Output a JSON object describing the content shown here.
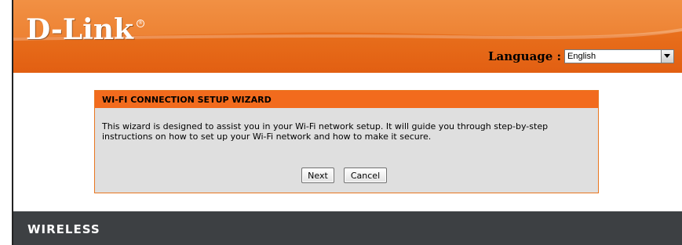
{
  "header": {
    "brand": "D-Link",
    "language_label": "Language :",
    "language_value": "English"
  },
  "wizard": {
    "title": "WI-FI CONNECTION SETUP WIZARD",
    "description": "This wizard is designed to assist you in your Wi-Fi network setup. It will guide you through step-by-step instructions on how to set up your Wi-Fi network and how to make it secure.",
    "next_label": "Next",
    "cancel_label": "Cancel"
  },
  "footer": {
    "label": "WIRELESS"
  },
  "colors": {
    "header_orange": "#e86f1c",
    "panel_title": "#f26b1d",
    "panel_bg": "#dfdfdf",
    "footer_bg": "#3d4043"
  },
  "icons": {
    "dropdown": "chevron-down-icon"
  }
}
